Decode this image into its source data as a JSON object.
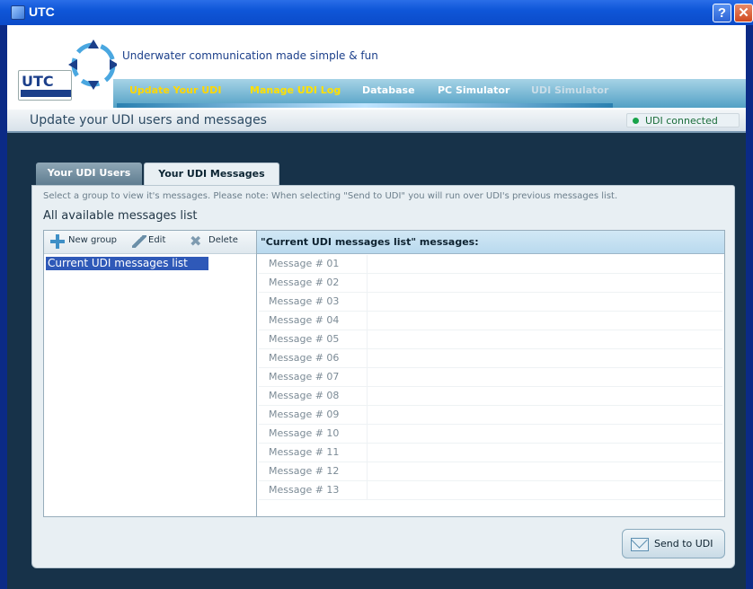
{
  "window": {
    "title": "UTC"
  },
  "header": {
    "logo_text": "UTC",
    "tagline": "Underwater communication made simple & fun",
    "nav": [
      {
        "label": "Update Your UDI"
      },
      {
        "label": "Manage UDI Log"
      },
      {
        "label": "Database"
      },
      {
        "label": "PC Simulator"
      },
      {
        "label": "UDI Simulator"
      }
    ]
  },
  "status": {
    "title": "Update your UDI users and messages",
    "connection": "UDI connected"
  },
  "tabs": [
    {
      "label": "Your UDI Users"
    },
    {
      "label": "Your UDI Messages"
    }
  ],
  "panel": {
    "note": "Select a group to view it's messages. Please note: When selecting \"Send to UDI\" you will run over UDI's previous messages list.",
    "heading": "All available messages list"
  },
  "toolbar": {
    "new_group": "New group",
    "edit": "Edit",
    "delete": "Delete"
  },
  "groups": [
    {
      "label": "Current UDI messages list"
    }
  ],
  "messages": {
    "header": "\"Current UDI messages list\" messages:",
    "rows": [
      "Message # 01",
      "Message # 02",
      "Message # 03",
      "Message # 04",
      "Message # 05",
      "Message # 06",
      "Message # 07",
      "Message # 08",
      "Message # 09",
      "Message # 10",
      "Message # 11",
      "Message # 12",
      "Message # 13"
    ]
  },
  "actions": {
    "send": "Send to UDI"
  },
  "colors": {
    "accent": "#0b4bc9",
    "nav_active": "#ffd700",
    "connected": "#18a34a",
    "selection": "#2f59b8"
  }
}
